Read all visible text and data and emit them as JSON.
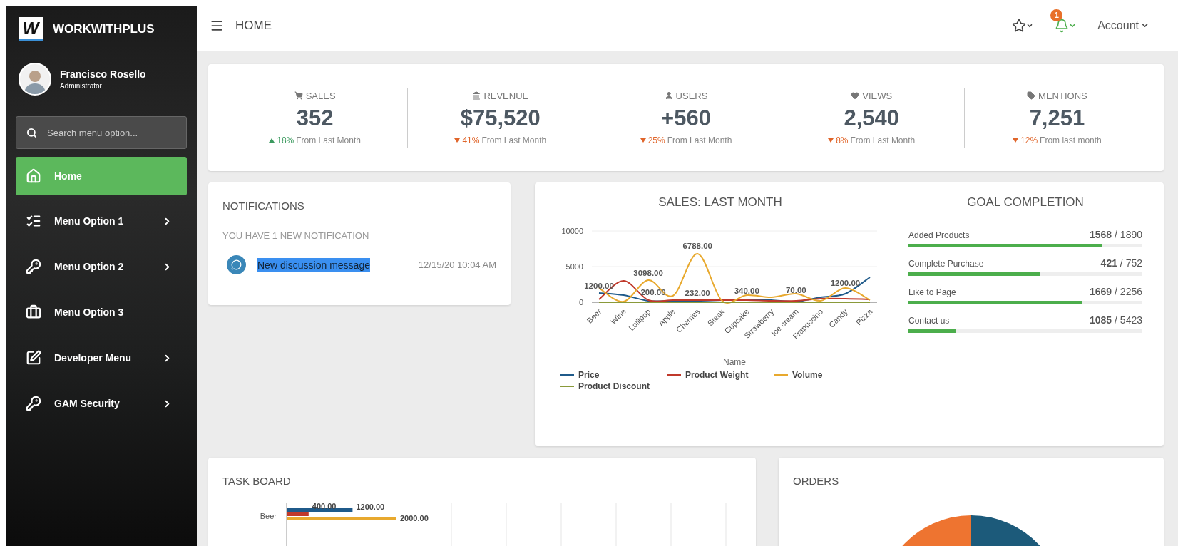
{
  "sidebar": {
    "brand": {
      "logo_text": "W",
      "name": "WORKWITHPLUS"
    },
    "user": {
      "name": "Francisco Rosello",
      "role": "Administrator"
    },
    "search": {
      "placeholder": "Search menu option..."
    },
    "items": [
      {
        "label": "Home",
        "selected": true,
        "has_submenu": false
      },
      {
        "label": "Menu Option 1",
        "selected": false,
        "has_submenu": true
      },
      {
        "label": "Menu Option 2",
        "selected": false,
        "has_submenu": true
      },
      {
        "label": "Menu Option 3",
        "selected": false,
        "has_submenu": false
      },
      {
        "label": "Developer Menu",
        "selected": false,
        "has_submenu": true
      },
      {
        "label": "GAM Security",
        "selected": false,
        "has_submenu": true
      }
    ]
  },
  "header": {
    "title": "HOME",
    "notification_count": "1",
    "account": "Account"
  },
  "stats": [
    {
      "label": "SALES",
      "value": "352",
      "change": "18%",
      "increase": true,
      "note": "From Last Month"
    },
    {
      "label": "REVENUE",
      "value": "$75,520",
      "change": "41%",
      "increase": false,
      "note": "From Last Month"
    },
    {
      "label": "USERS",
      "value": "+560",
      "change": "25%",
      "increase": false,
      "note": "From Last Month"
    },
    {
      "label": "VIEWS",
      "value": "2,540",
      "change": "8%",
      "increase": false,
      "note": "From Last Month"
    },
    {
      "label": "MENTIONS",
      "value": "7,251",
      "change": "12%",
      "increase": false,
      "note": "From last month"
    }
  ],
  "notifications": {
    "title": "NOTIFICATIONS",
    "summary": "YOU HAVE 1 NEW NOTIFICATION",
    "items": [
      {
        "message": "New discussion message",
        "time": "12/15/20 10:04 AM",
        "selected": true
      }
    ]
  },
  "sales_chart": {
    "chart_data": {
      "type": "line",
      "title": "SALES: LAST MONTH",
      "xlabel": "Name",
      "categories": [
        "Beer",
        "Wine",
        "Lollipop",
        "Apple",
        "Cherries",
        "Steak",
        "Cupcake",
        "Strawberry",
        "Ice cream",
        "Frapuccino",
        "Candy",
        "Pizza"
      ],
      "series": [
        {
          "name": "Price",
          "color": "#1f5a8a",
          "values": [
            1300,
            1000,
            200,
            200,
            200,
            300,
            400,
            300,
            100,
            700,
            1200,
            3500
          ]
        },
        {
          "name": "Product Weight",
          "color": "#c0392b",
          "values": [
            400,
            3000,
            300,
            300,
            300,
            300,
            300,
            200,
            200,
            500,
            500,
            400
          ]
        },
        {
          "name": "Volume",
          "color": "#e8a92e",
          "values": [
            2000,
            100,
            3098,
            900,
            6788,
            200,
            1000,
            700,
            1200,
            200,
            2000,
            300
          ]
        },
        {
          "name": "Product Discount",
          "color": "#8a9a3a",
          "values": [
            0,
            0,
            0,
            0,
            0,
            0,
            0,
            0,
            0,
            0,
            0,
            0
          ]
        }
      ],
      "ylim": [
        0,
        10000
      ],
      "yticks": [
        0,
        5000,
        10000
      ],
      "annotations": [
        "1200.00",
        "3098.00",
        "200.00",
        "6788.00",
        "232.00",
        "340.00",
        "70.00",
        "1200.00"
      ]
    }
  },
  "goals": {
    "title": "GOAL COMPLETION",
    "items": [
      {
        "label": "Added Products",
        "count": "**1568** / 1890",
        "level": 0.83
      },
      {
        "label": "Complete Purchase",
        "count": "**421** / 752",
        "level": 0.56
      },
      {
        "label": "Like to Page",
        "count": "**1669** / 2256",
        "level": 0.74
      },
      {
        "label": "Contact us",
        "count": "**1085** / 5423",
        "level": 0.2
      }
    ]
  },
  "task_board": {
    "title": "TASK BOARD",
    "chart_data": {
      "type": "bar",
      "orientation": "horizontal",
      "categories": [
        "Beer"
      ],
      "series": [
        {
          "color": "#1f5a8a",
          "values": [
            1200
          ],
          "value_labels": [
            "1200.00"
          ]
        },
        {
          "color": "#c0392b",
          "values": [
            400
          ],
          "value_labels": [
            "400.00"
          ]
        },
        {
          "color": "#e8a92e",
          "values": [
            2000
          ],
          "value_labels": [
            "2000.00"
          ]
        }
      ]
    }
  },
  "orders": {
    "title": "ORDERS"
  }
}
